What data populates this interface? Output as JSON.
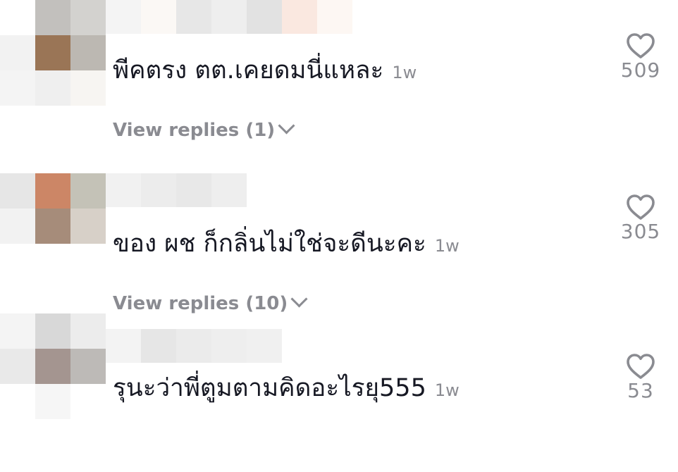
{
  "colors": {
    "text": "#161823",
    "muted": "#8a8b91",
    "background": "#ffffff"
  },
  "comments": [
    {
      "text": "พีคตรง ตต.เคยดมนี่แหละ",
      "time": "1w",
      "likes": "509",
      "replies_label": "View replies (1)",
      "avatar_colors": [
        "#c2c0bd",
        "#d3d2cf",
        "#f2f2f2",
        "#9a7556",
        "#bcb8b2",
        "#f4f4f4",
        "#efefef",
        "#f7f5f2",
        "#ffffff"
      ],
      "name_colors": [
        "#f4f4f4",
        "#fbf8f5",
        "#e7e7e7",
        "#eeeeee",
        "#e2e2e2",
        "#fae8e0",
        "#fdf7f3"
      ]
    },
    {
      "text": "ของ ผช ก็กลิ่นไม่ใช่จะดีนะคะ",
      "time": "1w",
      "likes": "305",
      "replies_label": "View replies (10)",
      "avatar_colors": [
        "#e6e6e6",
        "#cc8666",
        "#c4c2b7",
        "#f2f2f2",
        "#a68c7a",
        "#d7d0c8",
        "#ffffff",
        "#f5f5f5",
        "#ffffff"
      ],
      "name_colors": [
        "#f1f1f1",
        "#ececec",
        "#e8e8e8",
        "#eeeeee",
        "#f6f6f6",
        "#ffffff",
        "#ffffff"
      ]
    },
    {
      "text": "รุนะว่าพี่ตูมตามคิดอะไรยุ555",
      "time": "1w",
      "likes": "53",
      "replies_label": "",
      "avatar_colors": [
        "#f4f4f4",
        "#d8d8d8",
        "#ececec",
        "#e9e9e9",
        "#a49590",
        "#bdbab7",
        "#ffffff",
        "#f6f6f6",
        "#ffffff"
      ],
      "name_colors": [
        "#f3f3f3",
        "#e6e6e6",
        "#ebebeb",
        "#eeeeee",
        "#f0f0f0",
        "#ffffff",
        "#ffffff"
      ]
    }
  ]
}
